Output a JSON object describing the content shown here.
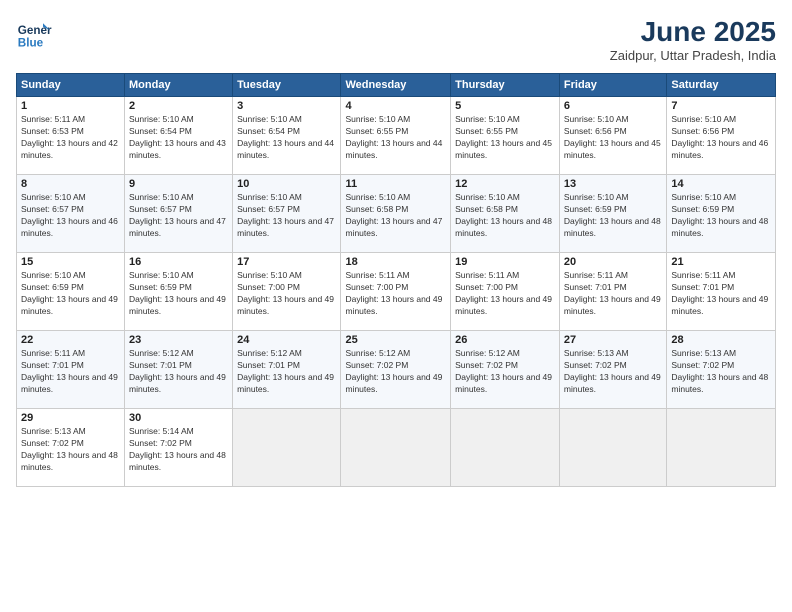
{
  "header": {
    "logo_line1": "General",
    "logo_line2": "Blue",
    "month": "June 2025",
    "location": "Zaidpur, Uttar Pradesh, India"
  },
  "weekdays": [
    "Sunday",
    "Monday",
    "Tuesday",
    "Wednesday",
    "Thursday",
    "Friday",
    "Saturday"
  ],
  "weeks": [
    [
      {
        "day": "1",
        "sunrise": "5:11 AM",
        "sunset": "6:53 PM",
        "daylight": "13 hours and 42 minutes."
      },
      {
        "day": "2",
        "sunrise": "5:10 AM",
        "sunset": "6:54 PM",
        "daylight": "13 hours and 43 minutes."
      },
      {
        "day": "3",
        "sunrise": "5:10 AM",
        "sunset": "6:54 PM",
        "daylight": "13 hours and 44 minutes."
      },
      {
        "day": "4",
        "sunrise": "5:10 AM",
        "sunset": "6:55 PM",
        "daylight": "13 hours and 44 minutes."
      },
      {
        "day": "5",
        "sunrise": "5:10 AM",
        "sunset": "6:55 PM",
        "daylight": "13 hours and 45 minutes."
      },
      {
        "day": "6",
        "sunrise": "5:10 AM",
        "sunset": "6:56 PM",
        "daylight": "13 hours and 45 minutes."
      },
      {
        "day": "7",
        "sunrise": "5:10 AM",
        "sunset": "6:56 PM",
        "daylight": "13 hours and 46 minutes."
      }
    ],
    [
      {
        "day": "8",
        "sunrise": "5:10 AM",
        "sunset": "6:57 PM",
        "daylight": "13 hours and 46 minutes."
      },
      {
        "day": "9",
        "sunrise": "5:10 AM",
        "sunset": "6:57 PM",
        "daylight": "13 hours and 47 minutes."
      },
      {
        "day": "10",
        "sunrise": "5:10 AM",
        "sunset": "6:57 PM",
        "daylight": "13 hours and 47 minutes."
      },
      {
        "day": "11",
        "sunrise": "5:10 AM",
        "sunset": "6:58 PM",
        "daylight": "13 hours and 47 minutes."
      },
      {
        "day": "12",
        "sunrise": "5:10 AM",
        "sunset": "6:58 PM",
        "daylight": "13 hours and 48 minutes."
      },
      {
        "day": "13",
        "sunrise": "5:10 AM",
        "sunset": "6:59 PM",
        "daylight": "13 hours and 48 minutes."
      },
      {
        "day": "14",
        "sunrise": "5:10 AM",
        "sunset": "6:59 PM",
        "daylight": "13 hours and 48 minutes."
      }
    ],
    [
      {
        "day": "15",
        "sunrise": "5:10 AM",
        "sunset": "6:59 PM",
        "daylight": "13 hours and 49 minutes."
      },
      {
        "day": "16",
        "sunrise": "5:10 AM",
        "sunset": "6:59 PM",
        "daylight": "13 hours and 49 minutes."
      },
      {
        "day": "17",
        "sunrise": "5:10 AM",
        "sunset": "7:00 PM",
        "daylight": "13 hours and 49 minutes."
      },
      {
        "day": "18",
        "sunrise": "5:11 AM",
        "sunset": "7:00 PM",
        "daylight": "13 hours and 49 minutes."
      },
      {
        "day": "19",
        "sunrise": "5:11 AM",
        "sunset": "7:00 PM",
        "daylight": "13 hours and 49 minutes."
      },
      {
        "day": "20",
        "sunrise": "5:11 AM",
        "sunset": "7:01 PM",
        "daylight": "13 hours and 49 minutes."
      },
      {
        "day": "21",
        "sunrise": "5:11 AM",
        "sunset": "7:01 PM",
        "daylight": "13 hours and 49 minutes."
      }
    ],
    [
      {
        "day": "22",
        "sunrise": "5:11 AM",
        "sunset": "7:01 PM",
        "daylight": "13 hours and 49 minutes."
      },
      {
        "day": "23",
        "sunrise": "5:12 AM",
        "sunset": "7:01 PM",
        "daylight": "13 hours and 49 minutes."
      },
      {
        "day": "24",
        "sunrise": "5:12 AM",
        "sunset": "7:01 PM",
        "daylight": "13 hours and 49 minutes."
      },
      {
        "day": "25",
        "sunrise": "5:12 AM",
        "sunset": "7:02 PM",
        "daylight": "13 hours and 49 minutes."
      },
      {
        "day": "26",
        "sunrise": "5:12 AM",
        "sunset": "7:02 PM",
        "daylight": "13 hours and 49 minutes."
      },
      {
        "day": "27",
        "sunrise": "5:13 AM",
        "sunset": "7:02 PM",
        "daylight": "13 hours and 49 minutes."
      },
      {
        "day": "28",
        "sunrise": "5:13 AM",
        "sunset": "7:02 PM",
        "daylight": "13 hours and 48 minutes."
      }
    ],
    [
      {
        "day": "29",
        "sunrise": "5:13 AM",
        "sunset": "7:02 PM",
        "daylight": "13 hours and 48 minutes."
      },
      {
        "day": "30",
        "sunrise": "5:14 AM",
        "sunset": "7:02 PM",
        "daylight": "13 hours and 48 minutes."
      },
      null,
      null,
      null,
      null,
      null
    ]
  ]
}
